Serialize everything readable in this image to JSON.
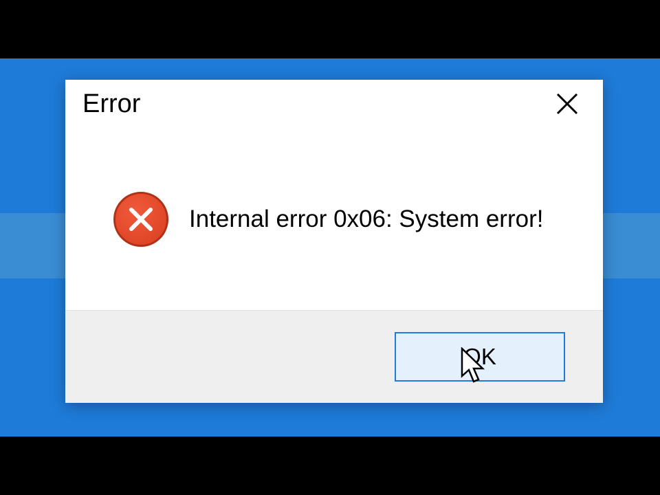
{
  "dialog": {
    "title": "Error",
    "message": "Internal error 0x06: System error!",
    "ok_label": "OK"
  },
  "colors": {
    "desktop_bg": "#1e7bd8",
    "error_icon": "#d83e20",
    "button_bg": "#e4f0fb",
    "button_border": "#1e7bd8"
  },
  "icons": {
    "close": "close-icon",
    "error": "error-x-icon",
    "cursor": "cursor-arrow-icon"
  }
}
